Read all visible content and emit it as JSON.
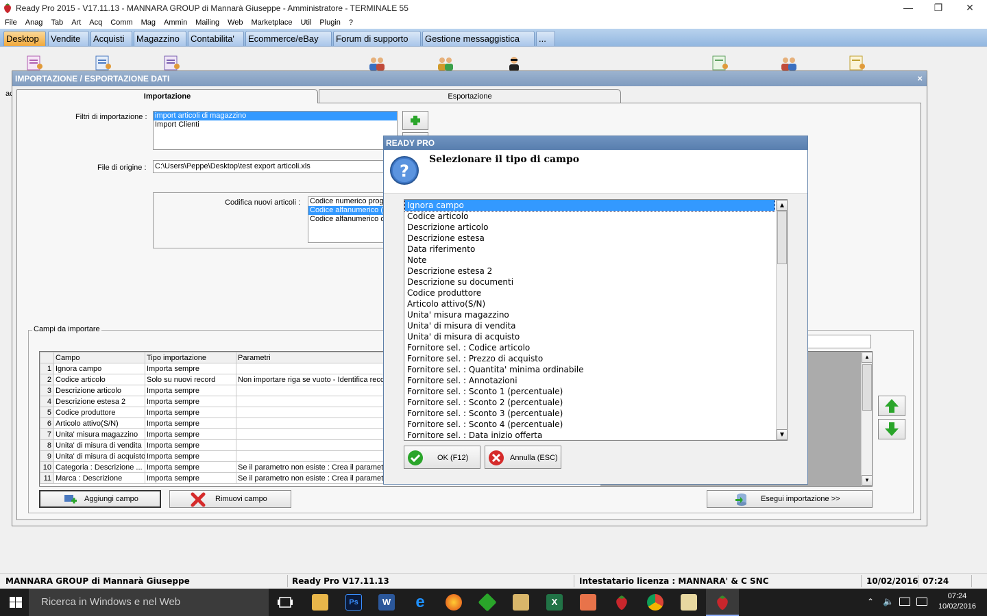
{
  "window": {
    "title": "Ready Pro 2015 - V17.11.13 - MANNARA GROUP di Mannarà Giuseppe - Amministratore - TERMINALE 55",
    "minimize_glyph": "—",
    "maximize_glyph": "❐",
    "close_glyph": "✕"
  },
  "menu": [
    "File",
    "Anag",
    "Tab",
    "Art",
    "Acq",
    "Comm",
    "Mag",
    "Ammin",
    "Mailing",
    "Web",
    "Marketplace",
    "Util",
    "Plugin",
    "?"
  ],
  "tabs": [
    "Desktop",
    "Vendite",
    "Acquisti",
    "Magazzino",
    "Contabilita'",
    "Ecommerce/eBay",
    "Forum di supporto",
    "Gestione messaggistica",
    "..."
  ],
  "dialog": {
    "title": "IMPORTAZIONE / ESPORTAZIONE DATI",
    "close": "×",
    "left_edge_text": "ac",
    "tab_import": "Importazione",
    "tab_export": "Esportazione",
    "filters_label": "Filtri di importazione :",
    "filters": [
      "import articoli di magazzino",
      "Import Clienti"
    ],
    "source_label": "File di origine :",
    "source_value": "C:\\Users\\Peppe\\Desktop\\test export articoli.xls",
    "encoding_label": "Codifica nuovi articoli :",
    "encoding_options": [
      "Codice numerico progr",
      "Codice alfanumerico (s",
      "Codice alfanumerico de"
    ],
    "fields_group": "Campi da importare",
    "grid_headers": [
      "",
      "Campo",
      "Tipo importazione",
      "Parametri"
    ],
    "grid_rows": [
      [
        "1",
        "Ignora campo",
        "Importa sempre",
        ""
      ],
      [
        "2",
        "Codice articolo",
        "Solo su nuovi record",
        "Non importare riga se vuoto - Identifica reco"
      ],
      [
        "3",
        "Descrizione articolo",
        "Importa sempre",
        ""
      ],
      [
        "4",
        "Descrizione estesa 2",
        "Importa sempre",
        ""
      ],
      [
        "5",
        "Codice produttore",
        "Importa sempre",
        ""
      ],
      [
        "6",
        "Articolo attivo(S/N)",
        "Importa sempre",
        ""
      ],
      [
        "7",
        "Unita' misura magazzino",
        "Importa sempre",
        ""
      ],
      [
        "8",
        "Unita' di misura di vendita",
        "Importa sempre",
        ""
      ],
      [
        "9",
        "Unita' di misura di acquisto",
        "Importa sempre",
        ""
      ],
      [
        "10",
        "Categoria : Descrizione ...",
        "Importa sempre",
        "Se il parametro non esiste : Crea il parametro"
      ],
      [
        "11",
        "Marca : Descrizione",
        "Importa sempre",
        "Se il parametro non esiste : Crea il parametro"
      ]
    ],
    "add_field": "Aggiungi campo",
    "remove_field": "Rimuovi campo",
    "run_import": "Esegui importazione >>"
  },
  "msgbox": {
    "title": "READY PRO",
    "question": "Selezionare il tipo di campo",
    "options": [
      "Ignora campo",
      "Codice articolo",
      "Descrizione articolo",
      "Descrizione estesa",
      "Data riferimento",
      "Note",
      "Descrizione estesa 2",
      "Descrizione su documenti",
      "Codice produttore",
      "Articolo attivo(S/N)",
      "Unita' misura magazzino",
      "Unita' di misura di vendita",
      "Unita' di misura di acquisto",
      "Fornitore sel. : Codice articolo",
      "Fornitore sel. : Prezzo di acquisto",
      "Fornitore sel. : Quantita' minima ordinabile",
      "Fornitore sel. : Annotazioni",
      "Fornitore sel. : Sconto 1 (percentuale)",
      "Fornitore sel. : Sconto 2 (percentuale)",
      "Fornitore sel. : Sconto 3 (percentuale)",
      "Fornitore sel. : Sconto 4 (percentuale)",
      "Fornitore sel. : Data inizio offerta"
    ],
    "ok": "OK (F12)",
    "cancel": "Annulla (ESC)"
  },
  "status": {
    "company": "MANNARA GROUP di Mannarà Giuseppe",
    "version": "Ready Pro V17.11.13",
    "license": "Intestatario licenza : MANNARA' & C SNC",
    "date": "10/02/2016",
    "time": "07:24"
  },
  "taskbar": {
    "search_placeholder": "Ricerca in Windows e nel Web",
    "clock_time": "07:24",
    "clock_date": "10/02/2016"
  },
  "colors": {
    "accent": "#3399ff",
    "tab_active": "#f1a93c",
    "dialog_header": "#7f9bbf",
    "msg_header": "#587eae",
    "green": "#2aa52a",
    "red": "#d52b2b"
  }
}
